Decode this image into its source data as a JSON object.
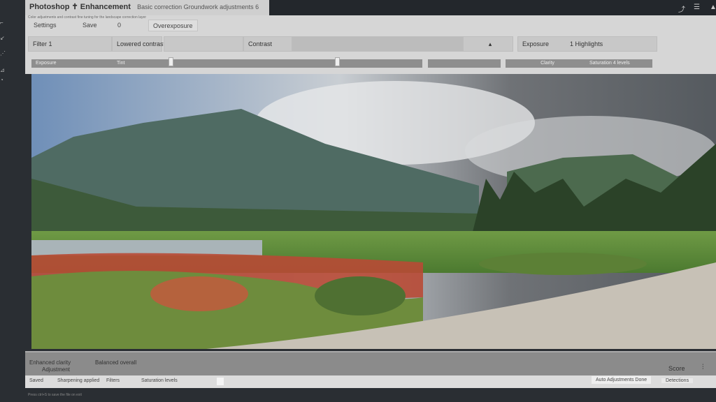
{
  "app": {
    "title": "Photoshop ✝ Enhancement",
    "title_extra": "Basic correction  Groundwork adjustments 6",
    "subtitle": "Color adjustments and contrast fine tuning for the landscape correction layer"
  },
  "toolbar_tabs": [
    "Settings",
    "Save",
    "0",
    "Overexposure"
  ],
  "fields": [
    "Filter 1",
    "Lowered contrast",
    "",
    "Contrast",
    "",
    "",
    "Exposure",
    "1 Highlights"
  ],
  "sliders": [
    "Exposure",
    "Tint",
    "",
    "",
    "",
    "Clarity",
    "Saturation 4 levels"
  ],
  "bottom_panel": {
    "line1a": "Enhanced clarity",
    "line1b": "Balanced overall",
    "line2": "Adjustment",
    "right_label": "Score",
    "right_icon": "menu-icon"
  },
  "status_bar": {
    "items": [
      "Saved",
      "Sharpening applied",
      "Filters",
      "Saturation levels"
    ],
    "right1": "Auto Adjustments Done",
    "right2": "Detections"
  },
  "footer": "Press ctrl+S to save the file on exit"
}
